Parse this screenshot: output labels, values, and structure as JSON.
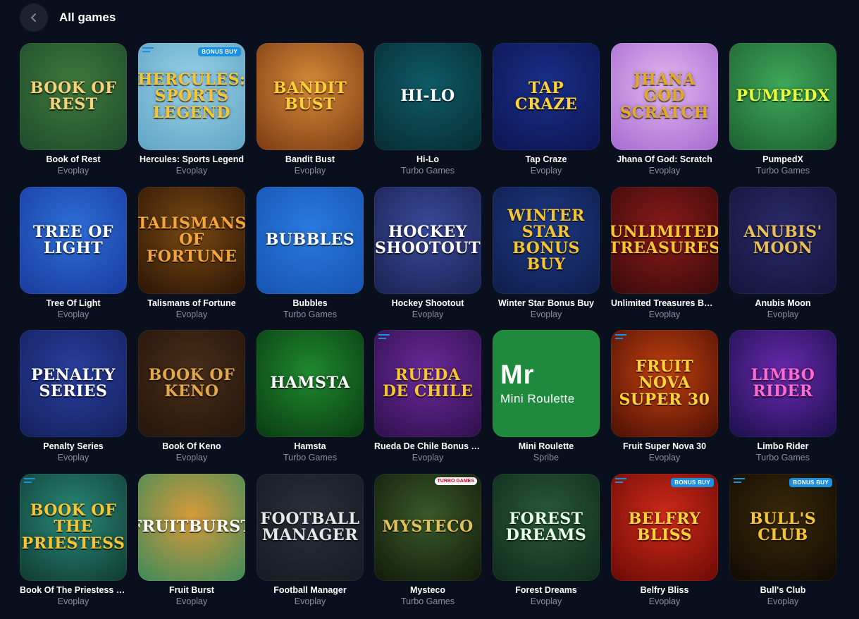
{
  "header": {
    "title": "All games",
    "back_icon": "chevron-left-icon"
  },
  "games": [
    {
      "name": "Book of Rest",
      "provider": "Evoplay",
      "art": "Book of Rest",
      "bg": "#3f7a3c",
      "bg2": "#1e4a2b",
      "fg": "#f5d27a"
    },
    {
      "name": "Hercules: Sports Legend",
      "provider": "Evoplay",
      "art": "Hercules: Sports Legend",
      "bg": "#9bd3e8",
      "bg2": "#5fa3c4",
      "fg": "#f7c531",
      "badge": "BONUS BUY",
      "mark": true
    },
    {
      "name": "Bandit Bust",
      "provider": "Evoplay",
      "art": "Bandit Bust",
      "bg": "#d98b3a",
      "bg2": "#7a3a12",
      "fg": "#ffcf3a"
    },
    {
      "name": "Hi-Lo",
      "provider": "Turbo Games",
      "art": "HI-LO",
      "bg": "#0f5b68",
      "bg2": "#062b33",
      "fg": "#ffffff"
    },
    {
      "name": "Tap Craze",
      "provider": "Evoplay",
      "art": "Tap Craze",
      "bg": "#1a2f8a",
      "bg2": "#0d1550",
      "fg": "#ffd23a"
    },
    {
      "name": "Jhana Of God: Scratch",
      "provider": "Evoplay",
      "art": "Jhana God Scratch",
      "bg": "#e3b8f0",
      "bg2": "#a56ad0",
      "fg": "#e3a826"
    },
    {
      "name": "PumpedX",
      "provider": "Turbo Games",
      "art": "PumpedX",
      "bg": "#3ea85a",
      "bg2": "#1d6030",
      "fg": "#e8ff3a"
    },
    {
      "name": "Tree Of Light",
      "provider": "Evoplay",
      "art": "Tree of Light",
      "bg": "#2d6fd8",
      "bg2": "#1a3a9c",
      "fg": "#ffffff"
    },
    {
      "name": "Talismans of Fortune",
      "provider": "Evoplay",
      "art": "Talismans of Fortune",
      "bg": "#7a4a12",
      "bg2": "#2a1406",
      "fg": "#f3a43a"
    },
    {
      "name": "Bubbles",
      "provider": "Turbo Games",
      "art": "Bubbles",
      "bg": "#2a7ae0",
      "bg2": "#1553b0",
      "fg": "#ffffff"
    },
    {
      "name": "Hockey Shootout",
      "provider": "Evoplay",
      "art": "Hockey Shootout",
      "bg": "#3a4a9c",
      "bg2": "#1a2250",
      "fg": "#ffffff"
    },
    {
      "name": "Winter Star Bonus Buy",
      "provider": "Evoplay",
      "art": "Winter Star Bonus Buy",
      "bg": "#1e3a86",
      "bg2": "#0e1c48",
      "fg": "#f7c531"
    },
    {
      "name": "Unlimited Treasures Bo…",
      "provider": "Evoplay",
      "art": "Unlimited Treasures",
      "bg": "#8a1a1a",
      "bg2": "#3a0a0a",
      "fg": "#f7c531"
    },
    {
      "name": "Anubis Moon",
      "provider": "Evoplay",
      "art": "Anubis' Moon",
      "bg": "#2a2a6a",
      "bg2": "#14143a",
      "fg": "#e8c05a"
    },
    {
      "name": "Penalty Series",
      "provider": "Evoplay",
      "art": "Penalty Series",
      "bg": "#2a3fa0",
      "bg2": "#141f5a",
      "fg": "#ffffff"
    },
    {
      "name": "Book Of Keno",
      "provider": "Evoplay",
      "art": "Book of Keno",
      "bg": "#4a2e1a",
      "bg2": "#22140a",
      "fg": "#e3a84a"
    },
    {
      "name": "Hamsta",
      "provider": "Turbo Games",
      "art": "Hamsta",
      "bg": "#1f8a2e",
      "bg2": "#0a3a12",
      "fg": "#ffffff"
    },
    {
      "name": "Rueda De Chile Bonus B…",
      "provider": "Evoplay",
      "art": "Rueda de Chile",
      "bg": "#6a2a9c",
      "bg2": "#2e0f4a",
      "fg": "#f7c531",
      "mark": true
    },
    {
      "name": "Mini Roulette",
      "provider": "Spribe",
      "art": "Mr",
      "art2": "Mini Roulette",
      "bg": "#1f8a3e",
      "bg2": "#1f8a3e",
      "fg": "#ffffff"
    },
    {
      "name": "Fruit Super Nova 30",
      "provider": "Evoplay",
      "art": "Fruit Nova Super 30",
      "bg": "#c2410f",
      "bg2": "#4a0f05",
      "fg": "#ffd23a",
      "mark": true
    },
    {
      "name": "Limbo Rider",
      "provider": "Turbo Games",
      "art": "Limbo Rider",
      "bg": "#6a2ab0",
      "bg2": "#1a0f4a",
      "fg": "#ff6ad0"
    },
    {
      "name": "Book Of The Priestess B…",
      "provider": "Evoplay",
      "art": "Book of the Priestess",
      "bg": "#2a8a7a",
      "bg2": "#0f3a30",
      "fg": "#f7c531",
      "mark": true
    },
    {
      "name": "Fruit Burst",
      "provider": "Evoplay",
      "art": "FruitBurst",
      "bg": "#d99a3a",
      "bg2": "#3a8a5a",
      "fg": "#ffffff"
    },
    {
      "name": "Football Manager",
      "provider": "Evoplay",
      "art": "Football Manager",
      "bg": "#2a2f3a",
      "bg2": "#161a22",
      "fg": "#e8e8e8"
    },
    {
      "name": "Mysteco",
      "provider": "Turbo Games",
      "art": "Mysteco",
      "bg": "#3a5a2a",
      "bg2": "#101a0a",
      "fg": "#e3c05a",
      "turbo": "TURBO GAMES"
    },
    {
      "name": "Forest Dreams",
      "provider": "Evoplay",
      "art": "Forest Dreams",
      "bg": "#2a5a3a",
      "bg2": "#0f2a1a",
      "fg": "#e8ffe8"
    },
    {
      "name": "Belfry Bliss",
      "provider": "Evoplay",
      "art": "Belfry Bliss",
      "bg": "#d02a1a",
      "bg2": "#6a0a05",
      "fg": "#ffd23a",
      "badge": "BONUS BUY",
      "mark": true
    },
    {
      "name": "Bull's Club",
      "provider": "Evoplay",
      "art": "Bull's Club",
      "bg": "#3a2a0a",
      "bg2": "#0f0a02",
      "fg": "#f7c531",
      "badge": "BONUS BUY",
      "mark": true
    }
  ]
}
